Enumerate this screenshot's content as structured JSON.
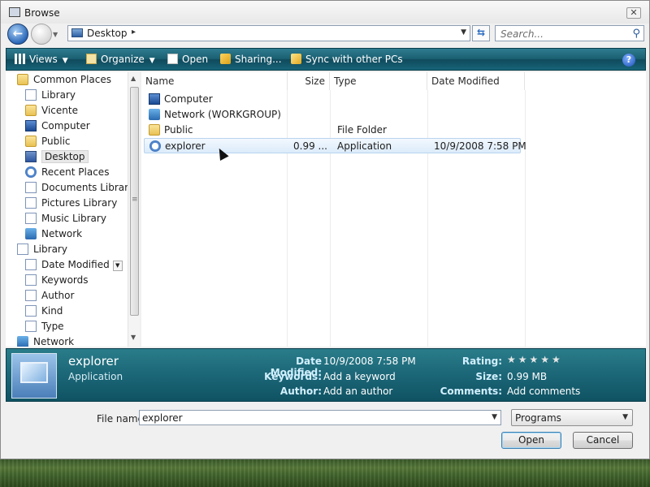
{
  "window": {
    "title": "Browse",
    "close_label": "✕"
  },
  "address": {
    "location": "Desktop",
    "chevron": "▸"
  },
  "search": {
    "placeholder": "Search..."
  },
  "toolbar": {
    "views": "Views",
    "organize": "Organize",
    "open": "Open",
    "sharing": "Sharing...",
    "sync": "Sync with other PCs",
    "help": "?"
  },
  "nav": {
    "items": [
      {
        "label": "Common Places",
        "icon": "folder-icon"
      },
      {
        "label": "Library",
        "icon": "library-icon"
      },
      {
        "label": "Vicente",
        "icon": "folder-icon"
      },
      {
        "label": "Computer",
        "icon": "computer-icon"
      },
      {
        "label": "Public",
        "icon": "folder-icon"
      },
      {
        "label": "Desktop",
        "icon": "desktop-icon",
        "selected": true
      },
      {
        "label": "Recent Places",
        "icon": "recent-icon"
      },
      {
        "label": "Documents Library",
        "icon": "library-icon"
      },
      {
        "label": "Pictures Library",
        "icon": "library-icon"
      },
      {
        "label": "Music Library",
        "icon": "library-icon"
      },
      {
        "label": "Network",
        "icon": "network-icon"
      },
      {
        "label": "Library",
        "icon": "library-icon"
      },
      {
        "label": "Date Modified",
        "icon": "library-icon"
      },
      {
        "label": "Keywords",
        "icon": "library-icon"
      },
      {
        "label": "Author",
        "icon": "library-icon"
      },
      {
        "label": "Kind",
        "icon": "library-icon"
      },
      {
        "label": "Type",
        "icon": "library-icon"
      },
      {
        "label": "Network",
        "icon": "network-icon"
      }
    ]
  },
  "columns": {
    "name": "Name",
    "size": "Size",
    "type": "Type",
    "date": "Date Modified"
  },
  "files": [
    {
      "name": "Computer",
      "size": "",
      "type": "",
      "date": "",
      "icon": "computer-icon"
    },
    {
      "name": "Network (WORKGROUP)",
      "size": "",
      "type": "",
      "date": "",
      "icon": "network-icon"
    },
    {
      "name": "Public",
      "size": "",
      "type": "File Folder",
      "date": "",
      "icon": "folder-icon"
    },
    {
      "name": "explorer",
      "size": "0.99 ...",
      "type": "Application",
      "date": "10/9/2008 7:58 PM",
      "icon": "application-icon",
      "selected": true
    }
  ],
  "details": {
    "name": "explorer",
    "type": "Application",
    "date_modified_key": "Date Modified:",
    "date_modified": "10/9/2008 7:58 PM",
    "keywords_key": "Keywords:",
    "keywords": "Add a keyword",
    "author_key": "Author:",
    "author": "Add an author",
    "rating_key": "Rating:",
    "rating_stars": "★★★★★",
    "rating_value": 0,
    "size_key": "Size:",
    "size": "0.99 MB",
    "comments_key": "Comments:",
    "comments": "Add comments"
  },
  "bottom": {
    "file_name_label": "File name:",
    "file_name_value": "explorer",
    "file_type": "Programs",
    "open_button": "Open",
    "cancel_button": "Cancel"
  },
  "colors": {
    "toolbar": "#1b5f72",
    "details": "#1b6677",
    "selection": "#dcebfa"
  }
}
